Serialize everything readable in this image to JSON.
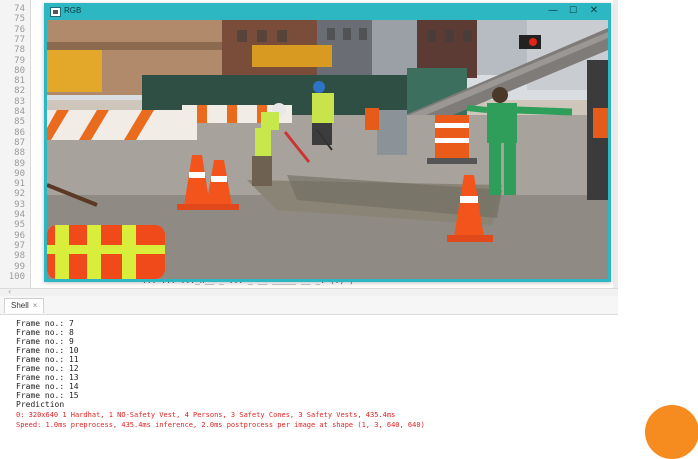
{
  "editor": {
    "line_numbers": [
      "74",
      "75",
      "76",
      "77",
      "78",
      "79",
      "80",
      "81",
      "82",
      "83",
      "84",
      "85",
      "86",
      "87",
      "88",
      "89",
      "90",
      "91",
      "92",
      "93",
      "94",
      "95",
      "96",
      "97",
      "98",
      "99",
      "100"
    ],
    "code_peek": "   ...    ...    ..._n__ _ ... _ __ _____ __ _. (.) )"
  },
  "cv_window": {
    "title": "RGB",
    "controls": {
      "minimize": "—",
      "maximize": "☐",
      "close": "✕"
    }
  },
  "shell": {
    "tab_label": "Shell",
    "tab_close": "×",
    "lines": [
      "Frame no.: 7",
      "Frame no.: 8",
      "Frame no.: 9",
      "Frame no.: 10",
      "Frame no.: 11",
      "Frame no.: 12",
      "Frame no.: 13",
      "Frame no.: 14",
      "Frame no.: 15",
      "Prediction"
    ],
    "result_line": "0: 320x640 1 Hardhat, 1 NO-Safety Vest, 4 Persons, 3 Safety Cones, 3 Safety Vests, 435.4ms",
    "speed_line": "Speed: 1.0ms preprocess, 435.4ms inference, 2.0ms postprocess per image at shape (1, 3, 640, 640)"
  },
  "colors": {
    "window_accent": "#2cb7c3",
    "error_text": "#e02424",
    "decor_orange": "#f68b1f"
  }
}
